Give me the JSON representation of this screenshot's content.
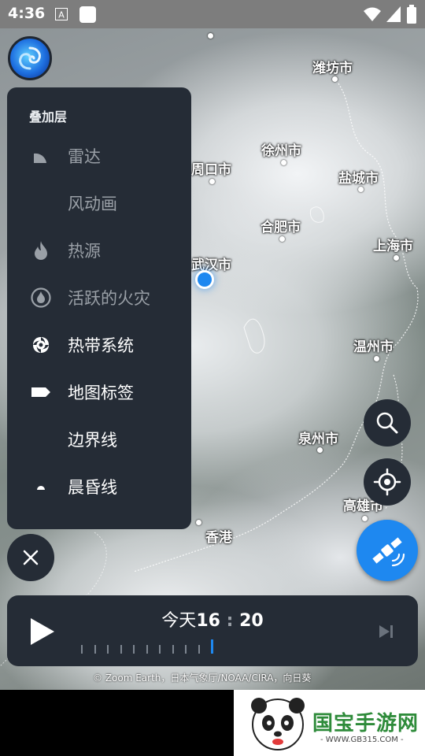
{
  "status_bar": {
    "time": "4:36",
    "icons": [
      "keyboard-a-icon",
      "app-square-icon",
      "wifi-icon",
      "signal-icon",
      "battery-icon"
    ]
  },
  "map": {
    "cities": [
      {
        "name": "潍坊市"
      },
      {
        "name": "徐州市"
      },
      {
        "name": "周口市"
      },
      {
        "name": "盐城市"
      },
      {
        "name": "合肥市"
      },
      {
        "name": "上海市"
      },
      {
        "name": "武汉市"
      },
      {
        "name": "温州市"
      },
      {
        "name": "泉州市"
      },
      {
        "name": "高雄市"
      },
      {
        "name": "香港"
      }
    ],
    "attribution": "© Zoom Earth，日本气象厅/NOAA/CIRA，向日葵"
  },
  "layers_panel": {
    "title": "叠加层",
    "items": [
      {
        "label": "雷达",
        "icon": "radar-icon",
        "enabled": false
      },
      {
        "label": "风动画",
        "icon": "",
        "enabled": false
      },
      {
        "label": "热源",
        "icon": "flame-icon",
        "enabled": false
      },
      {
        "label": "活跃的火灾",
        "icon": "fire-circle-icon",
        "enabled": false
      },
      {
        "label": "热带系统",
        "icon": "hurricane-icon",
        "enabled": true
      },
      {
        "label": "地图标签",
        "icon": "label-tag-icon",
        "enabled": true
      },
      {
        "label": "边界线",
        "icon": "",
        "enabled": true
      },
      {
        "label": "晨昏线",
        "icon": "terminator-icon",
        "enabled": true
      }
    ]
  },
  "timeline": {
    "day": "今天",
    "hour": "16",
    "minute": "20",
    "tick_count": 11,
    "active_tick_index": 10
  },
  "watermark": {
    "brand": "国宝手游网",
    "url": "- WWW.GB315.COM -"
  },
  "colors": {
    "panel_bg": "#252c36",
    "accent_blue": "#1e88f0",
    "dim_text": "#9aa0a7"
  }
}
